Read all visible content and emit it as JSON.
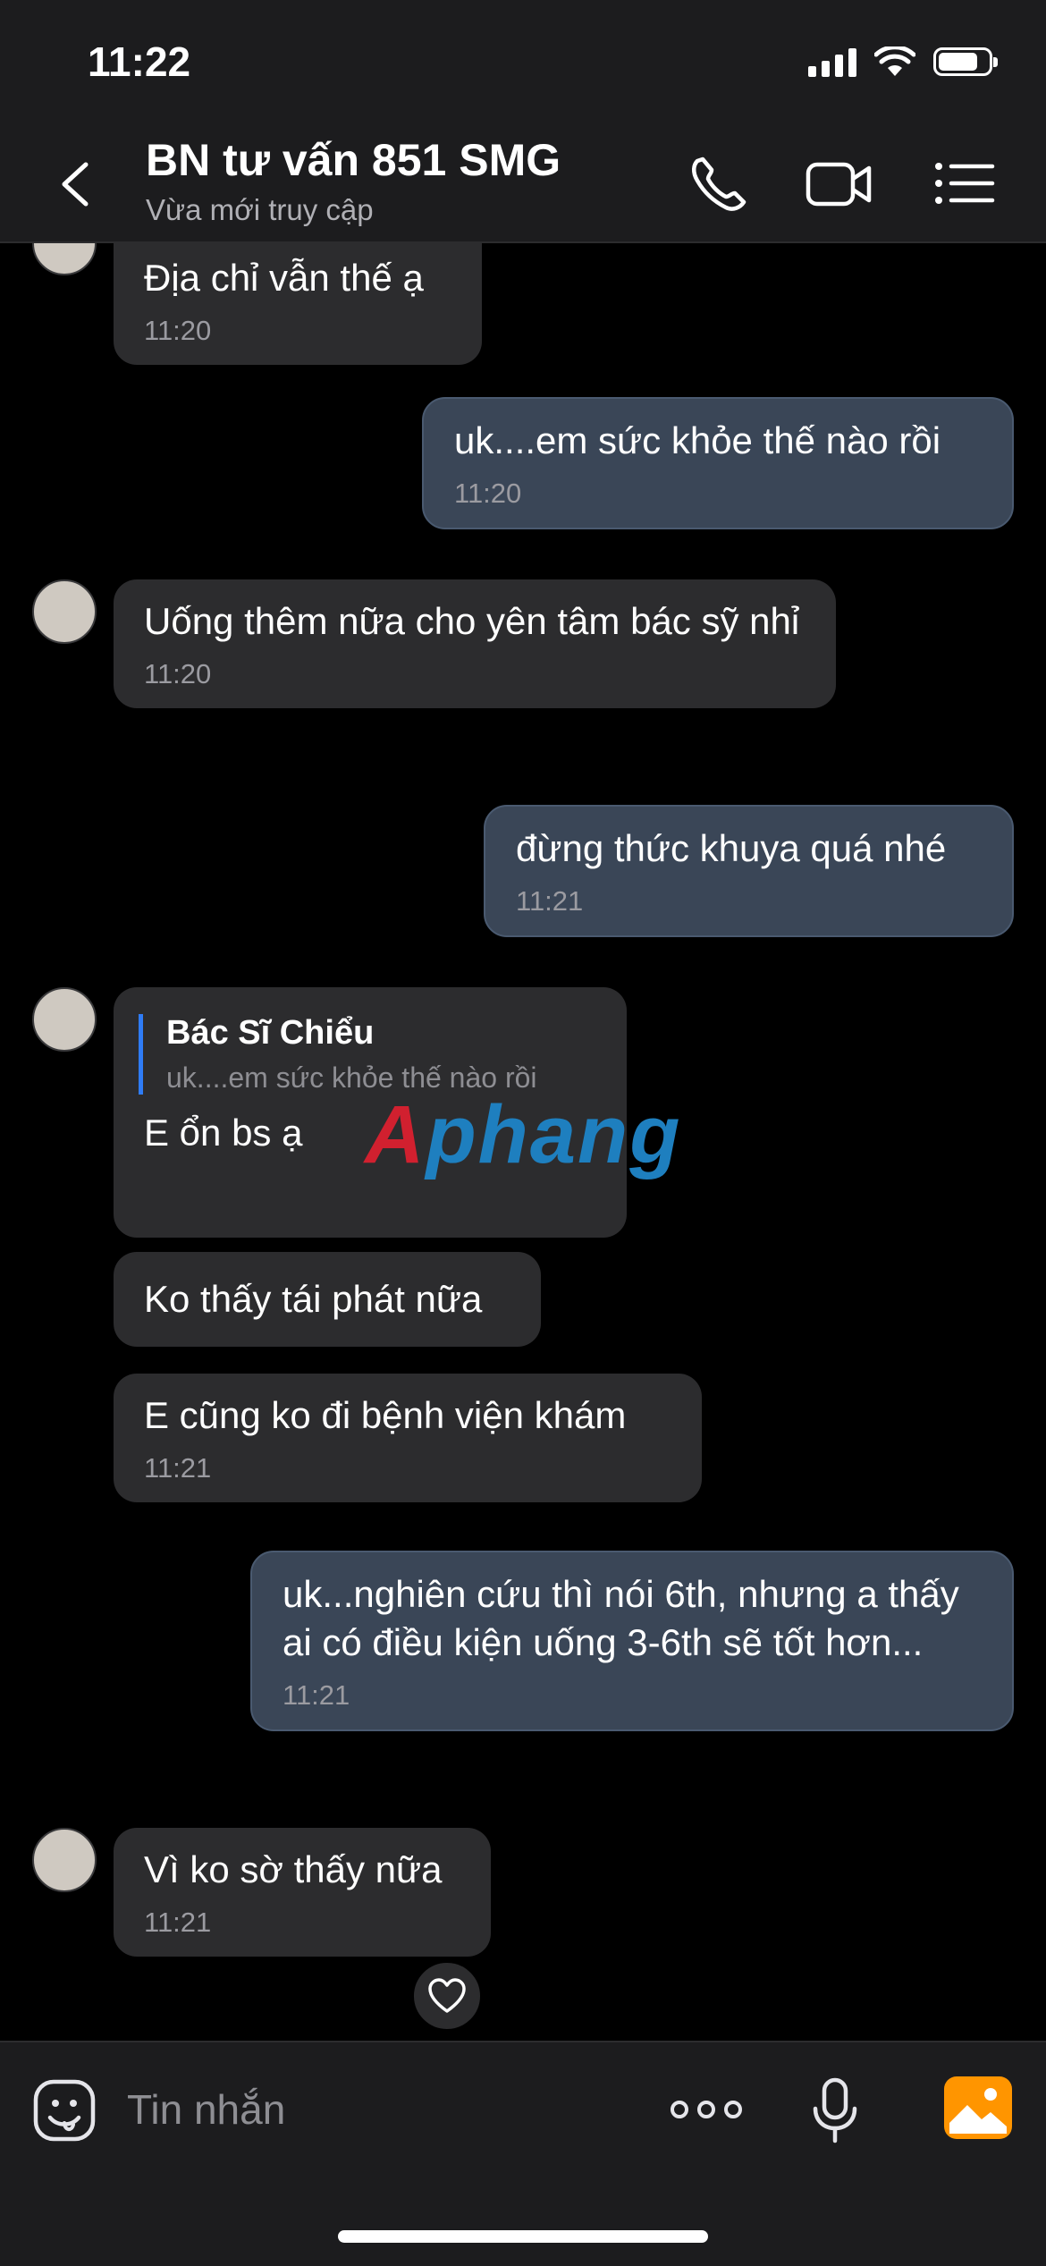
{
  "status_bar": {
    "time": "11:22"
  },
  "header": {
    "title": "BN tư vấn 851 SMG",
    "subtitle": "Vừa mới truy cập",
    "icons": [
      "back-chevron-icon",
      "phone-icon",
      "video-call-icon",
      "list-menu-icon"
    ]
  },
  "messages": [
    {
      "side": "in",
      "text": "Địa chỉ vẫn thế ạ",
      "time": "11:20"
    },
    {
      "side": "out",
      "text": "uk....em sức khỏe thế nào rồi",
      "time": "11:20"
    },
    {
      "side": "in",
      "text": "Uống thêm nữa cho yên tâm bác sỹ nhỉ",
      "time": "11:20"
    },
    {
      "side": "out",
      "text": "đừng thức khuya quá nhé",
      "time": "11:21"
    },
    {
      "side": "in",
      "quote": {
        "name": "Bác Sĩ Chiểu",
        "text": "uk....em sức khỏe thế nào rồi"
      },
      "text": "E ổn bs ạ"
    },
    {
      "side": "in",
      "text": "Ko thấy tái phát nữa"
    },
    {
      "side": "in",
      "text": "E cũng ko đi bệnh viện khám",
      "time": "11:21"
    },
    {
      "side": "out",
      "text": "uk...nghiên cứu thì nói 6th, nhưng a thấy ai có điều kiện uống 3-6th sẽ tốt hơn...",
      "time": "11:21"
    },
    {
      "side": "in",
      "text": "Vì ko sờ thấy nữa",
      "time": "11:21"
    }
  ],
  "watermark": {
    "part1": "A",
    "part2": "phang"
  },
  "input": {
    "placeholder": "Tin nhắn"
  },
  "colors": {
    "outgoing_bubble": "#3a4657",
    "incoming_bubble": "#2c2c2e",
    "accent": "#ff9500",
    "quote_bar": "#2f7cf6"
  }
}
